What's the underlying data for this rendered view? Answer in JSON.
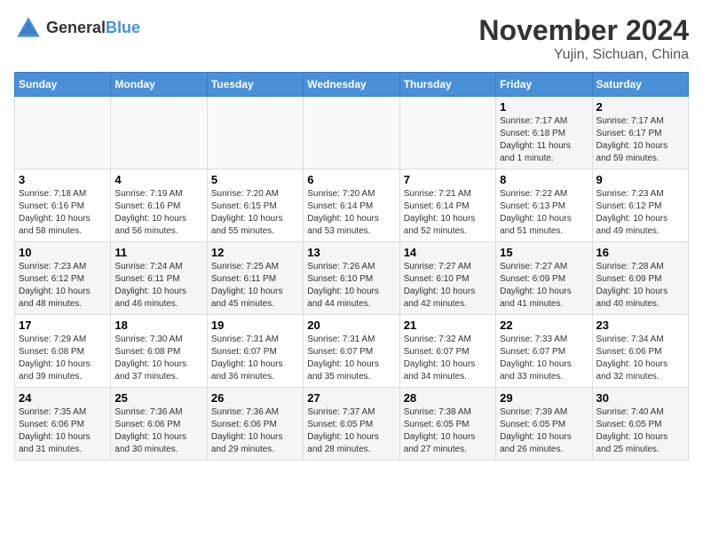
{
  "header": {
    "logo_general": "General",
    "logo_blue": "Blue",
    "month_year": "November 2024",
    "location": "Yujin, Sichuan, China"
  },
  "days_of_week": [
    "Sunday",
    "Monday",
    "Tuesday",
    "Wednesday",
    "Thursday",
    "Friday",
    "Saturday"
  ],
  "weeks": [
    {
      "days": [
        {
          "num": "",
          "info": ""
        },
        {
          "num": "",
          "info": ""
        },
        {
          "num": "",
          "info": ""
        },
        {
          "num": "",
          "info": ""
        },
        {
          "num": "",
          "info": ""
        },
        {
          "num": "1",
          "info": "Sunrise: 7:17 AM\nSunset: 6:18 PM\nDaylight: 11 hours\nand 1 minute."
        },
        {
          "num": "2",
          "info": "Sunrise: 7:17 AM\nSunset: 6:17 PM\nDaylight: 10 hours\nand 59 minutes."
        }
      ]
    },
    {
      "days": [
        {
          "num": "3",
          "info": "Sunrise: 7:18 AM\nSunset: 6:16 PM\nDaylight: 10 hours\nand 58 minutes."
        },
        {
          "num": "4",
          "info": "Sunrise: 7:19 AM\nSunset: 6:16 PM\nDaylight: 10 hours\nand 56 minutes."
        },
        {
          "num": "5",
          "info": "Sunrise: 7:20 AM\nSunset: 6:15 PM\nDaylight: 10 hours\nand 55 minutes."
        },
        {
          "num": "6",
          "info": "Sunrise: 7:20 AM\nSunset: 6:14 PM\nDaylight: 10 hours\nand 53 minutes."
        },
        {
          "num": "7",
          "info": "Sunrise: 7:21 AM\nSunset: 6:14 PM\nDaylight: 10 hours\nand 52 minutes."
        },
        {
          "num": "8",
          "info": "Sunrise: 7:22 AM\nSunset: 6:13 PM\nDaylight: 10 hours\nand 51 minutes."
        },
        {
          "num": "9",
          "info": "Sunrise: 7:23 AM\nSunset: 6:12 PM\nDaylight: 10 hours\nand 49 minutes."
        }
      ]
    },
    {
      "days": [
        {
          "num": "10",
          "info": "Sunrise: 7:23 AM\nSunset: 6:12 PM\nDaylight: 10 hours\nand 48 minutes."
        },
        {
          "num": "11",
          "info": "Sunrise: 7:24 AM\nSunset: 6:11 PM\nDaylight: 10 hours\nand 46 minutes."
        },
        {
          "num": "12",
          "info": "Sunrise: 7:25 AM\nSunset: 6:11 PM\nDaylight: 10 hours\nand 45 minutes."
        },
        {
          "num": "13",
          "info": "Sunrise: 7:26 AM\nSunset: 6:10 PM\nDaylight: 10 hours\nand 44 minutes."
        },
        {
          "num": "14",
          "info": "Sunrise: 7:27 AM\nSunset: 6:10 PM\nDaylight: 10 hours\nand 42 minutes."
        },
        {
          "num": "15",
          "info": "Sunrise: 7:27 AM\nSunset: 6:09 PM\nDaylight: 10 hours\nand 41 minutes."
        },
        {
          "num": "16",
          "info": "Sunrise: 7:28 AM\nSunset: 6:09 PM\nDaylight: 10 hours\nand 40 minutes."
        }
      ]
    },
    {
      "days": [
        {
          "num": "17",
          "info": "Sunrise: 7:29 AM\nSunset: 6:08 PM\nDaylight: 10 hours\nand 39 minutes."
        },
        {
          "num": "18",
          "info": "Sunrise: 7:30 AM\nSunset: 6:08 PM\nDaylight: 10 hours\nand 37 minutes."
        },
        {
          "num": "19",
          "info": "Sunrise: 7:31 AM\nSunset: 6:07 PM\nDaylight: 10 hours\nand 36 minutes."
        },
        {
          "num": "20",
          "info": "Sunrise: 7:31 AM\nSunset: 6:07 PM\nDaylight: 10 hours\nand 35 minutes."
        },
        {
          "num": "21",
          "info": "Sunrise: 7:32 AM\nSunset: 6:07 PM\nDaylight: 10 hours\nand 34 minutes."
        },
        {
          "num": "22",
          "info": "Sunrise: 7:33 AM\nSunset: 6:07 PM\nDaylight: 10 hours\nand 33 minutes."
        },
        {
          "num": "23",
          "info": "Sunrise: 7:34 AM\nSunset: 6:06 PM\nDaylight: 10 hours\nand 32 minutes."
        }
      ]
    },
    {
      "days": [
        {
          "num": "24",
          "info": "Sunrise: 7:35 AM\nSunset: 6:06 PM\nDaylight: 10 hours\nand 31 minutes."
        },
        {
          "num": "25",
          "info": "Sunrise: 7:36 AM\nSunset: 6:06 PM\nDaylight: 10 hours\nand 30 minutes."
        },
        {
          "num": "26",
          "info": "Sunrise: 7:36 AM\nSunset: 6:06 PM\nDaylight: 10 hours\nand 29 minutes."
        },
        {
          "num": "27",
          "info": "Sunrise: 7:37 AM\nSunset: 6:05 PM\nDaylight: 10 hours\nand 28 minutes."
        },
        {
          "num": "28",
          "info": "Sunrise: 7:38 AM\nSunset: 6:05 PM\nDaylight: 10 hours\nand 27 minutes."
        },
        {
          "num": "29",
          "info": "Sunrise: 7:39 AM\nSunset: 6:05 PM\nDaylight: 10 hours\nand 26 minutes."
        },
        {
          "num": "30",
          "info": "Sunrise: 7:40 AM\nSunset: 6:05 PM\nDaylight: 10 hours\nand 25 minutes."
        }
      ]
    }
  ]
}
